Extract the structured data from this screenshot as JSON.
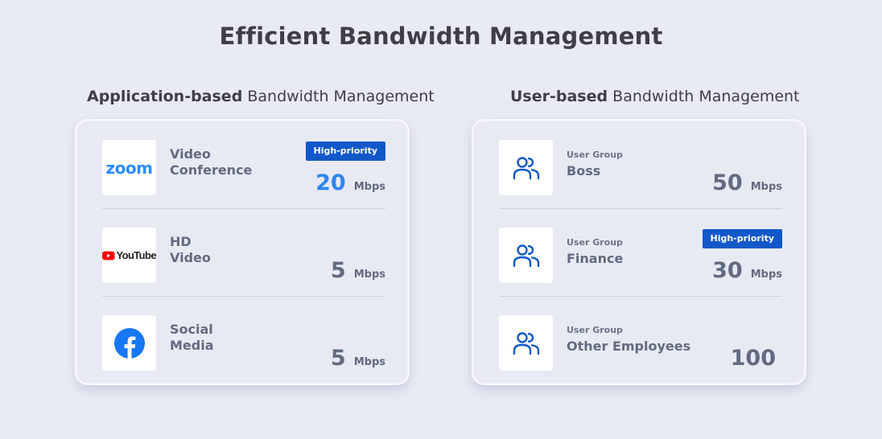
{
  "title": "Efficient Bandwidth Management",
  "left": {
    "heading_bold": "Application-based",
    "heading_rest": "Bandwidth Management",
    "rows": [
      {
        "logo": "zoom-logo",
        "logo_text": "zoom",
        "label": "Video Conference",
        "badge": "High-priority",
        "value": "20",
        "unit": "Mbps"
      },
      {
        "logo": "youtube-logo",
        "logo_text": "YouTube",
        "label": "HD Video",
        "value": "5",
        "unit": "Mbps"
      },
      {
        "logo": "facebook-logo",
        "label": "Social Media",
        "value": "5",
        "unit": "Mbps"
      }
    ]
  },
  "right": {
    "heading_bold": "User-based",
    "heading_rest": "Bandwidth Management",
    "rows": [
      {
        "icon": "user-group-icon",
        "small": "User Group",
        "name": "Boss",
        "value": "50",
        "unit": "Mbps"
      },
      {
        "icon": "user-group-icon",
        "small": "User Group",
        "name": "Finance",
        "badge": "High-priority",
        "value": "30",
        "unit": "Mbps"
      },
      {
        "icon": "user-group-icon",
        "small": "User Group",
        "name": "Other Employees",
        "value": "100"
      }
    ]
  },
  "colors": {
    "accent": "#1258c8",
    "highlight_value": "#2f86f0",
    "text": "#626b80",
    "background": "#e9ebf4"
  }
}
